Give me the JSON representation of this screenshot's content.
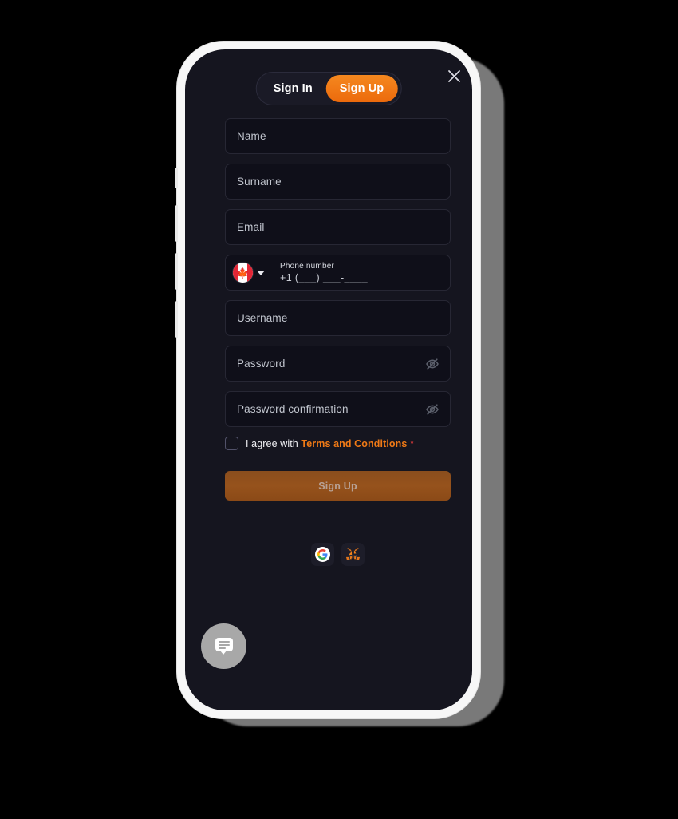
{
  "window": {
    "background_color": "#000000"
  },
  "device": {
    "frame_color": "#f7f7f7",
    "screen_background": "#15151f"
  },
  "modal": {
    "close_icon": "close-icon",
    "tabs": [
      {
        "label": "Sign In",
        "active": false
      },
      {
        "label": "Sign Up",
        "active": true
      }
    ],
    "accent_color": "#f07a16"
  },
  "form": {
    "fields": [
      {
        "name": "name",
        "placeholder": "Name",
        "value": "",
        "type": "text"
      },
      {
        "name": "surname",
        "placeholder": "Surname",
        "value": "",
        "type": "text"
      },
      {
        "name": "email",
        "placeholder": "Email",
        "value": "",
        "type": "email"
      }
    ],
    "phone": {
      "country_flag": "canada-flag-icon",
      "country_code": "+1",
      "label": "Phone number",
      "placeholder": "+1 (___) ___-____",
      "value": ""
    },
    "username": {
      "placeholder": "Username",
      "value": ""
    },
    "password": {
      "placeholder": "Password",
      "value": "",
      "toggle_icon": "eye-off-icon"
    },
    "password_confirmation": {
      "placeholder": "Password confirmation",
      "value": "",
      "toggle_icon": "eye-off-icon"
    },
    "terms": {
      "checked": false,
      "prefix": "I agree with",
      "link": "Terms and Conditions",
      "required_marker": "*"
    },
    "submit": {
      "label": "Sign Up",
      "enabled": false
    }
  },
  "social": {
    "providers": [
      {
        "name": "google",
        "icon": "google-icon",
        "label": "G"
      },
      {
        "name": "metamask",
        "icon": "metamask-fox-icon"
      }
    ]
  },
  "support": {
    "chat_button_icon": "chat-bubble-icon"
  }
}
